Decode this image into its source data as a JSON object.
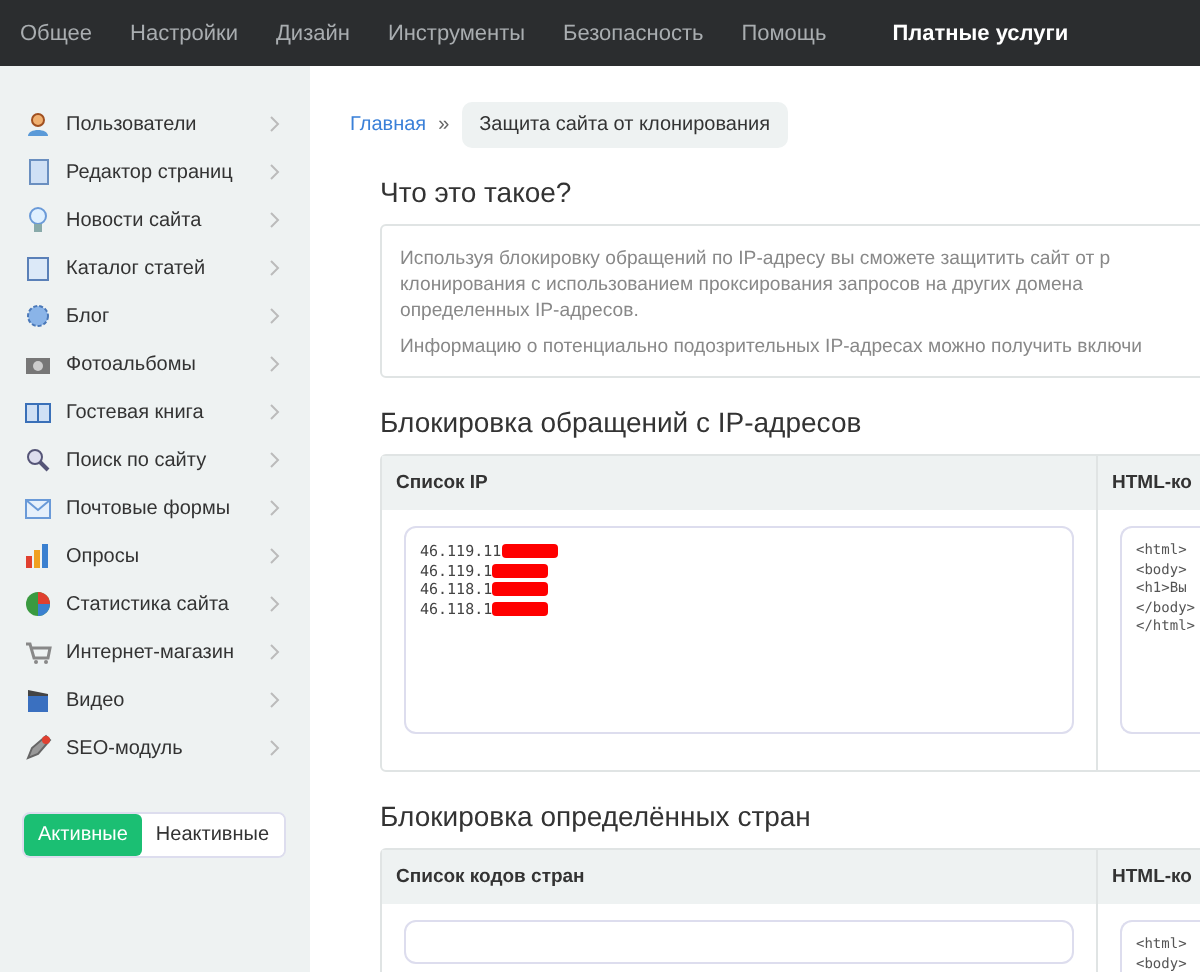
{
  "top_nav": [
    {
      "label": "Общее",
      "selected": false
    },
    {
      "label": "Настройки",
      "selected": false
    },
    {
      "label": "Дизайн",
      "selected": false
    },
    {
      "label": "Инструменты",
      "selected": false
    },
    {
      "label": "Безопасность",
      "selected": false
    },
    {
      "label": "Помощь",
      "selected": false
    },
    {
      "label": "Платные услуги",
      "selected": true
    }
  ],
  "sidebar": {
    "items": [
      {
        "label": "Пользователи"
      },
      {
        "label": "Редактор страниц"
      },
      {
        "label": "Новости сайта"
      },
      {
        "label": "Каталог статей"
      },
      {
        "label": "Блог"
      },
      {
        "label": "Фотоальбомы"
      },
      {
        "label": "Гостевая книга"
      },
      {
        "label": "Поиск по сайту"
      },
      {
        "label": "Почтовые формы"
      },
      {
        "label": "Опросы"
      },
      {
        "label": "Статистика сайта"
      },
      {
        "label": "Интернет-магазин"
      },
      {
        "label": "Видео"
      },
      {
        "label": "SEO-модуль"
      }
    ],
    "filter": [
      {
        "label": "Активные",
        "selected": true
      },
      {
        "label": "Неактивные",
        "selected": false
      }
    ]
  },
  "breadcrumb": {
    "link": "Главная",
    "separator": "»",
    "current": "Защита сайта от клонирования"
  },
  "about": {
    "title": "Что это такое?",
    "lines": [
      "Используя блокировку обращений по IP-адресу вы сможете защитить сайт от р",
      "клонирования с использованием проксирования запросов на других домена",
      "определенных IP-адресов."
    ],
    "note": "Информацию о потенциально подозрительных IP-адресах можно получить включи"
  },
  "sections": [
    {
      "title": "Блокировка обращений с IP-адресов",
      "column_1": "Список IP",
      "column_2": "HTML-ко",
      "kind": "textarea",
      "entries": [
        "46.119.11",
        "46.119.1",
        "46.118.1",
        "46.118.1"
      ],
      "code": [
        "<html>",
        "<body>",
        "<h1>Вы",
        "</body>",
        "</html>"
      ]
    },
    {
      "title": "Блокировка определённых стран",
      "column_1": "Список кодов стран",
      "column_2": "HTML-ко",
      "kind": "input",
      "code": [
        "<html>",
        "<body>"
      ]
    }
  ]
}
